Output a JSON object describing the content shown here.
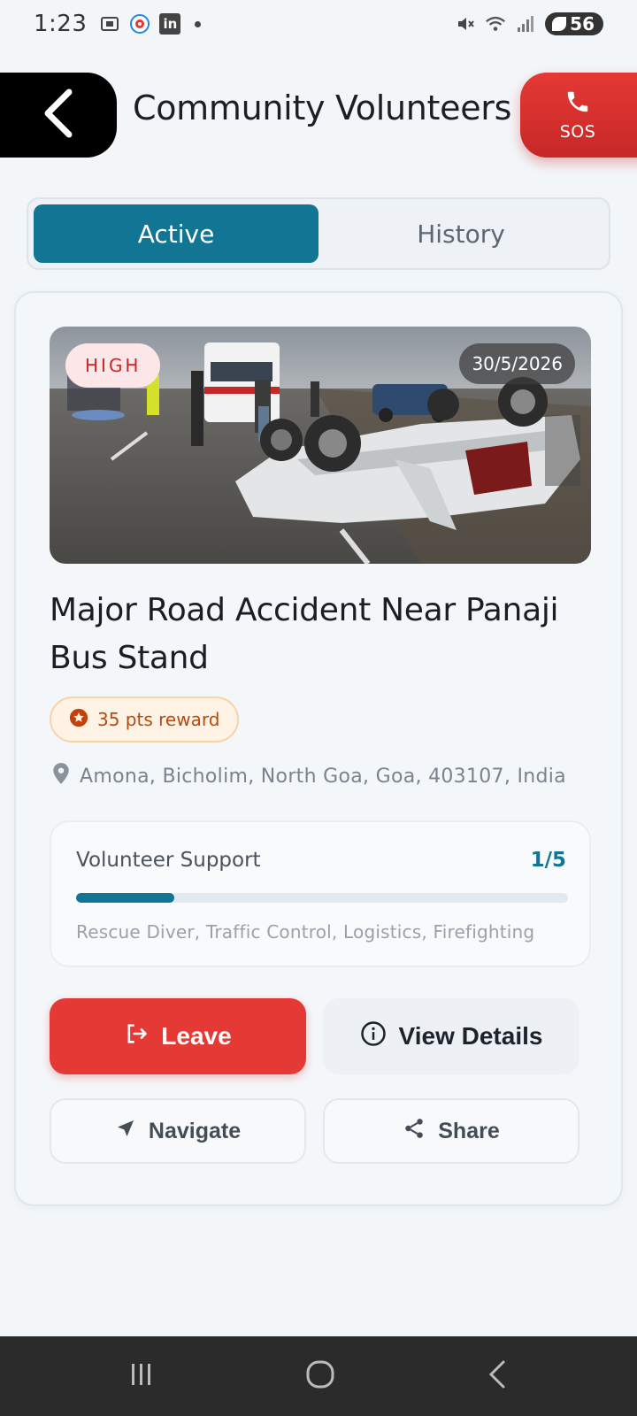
{
  "status_bar": {
    "time": "1:23",
    "battery": "56",
    "icons": [
      "screenshot-icon",
      "app-icon",
      "linkedin-icon",
      "notification-dot",
      "mute-icon",
      "wifi-icon",
      "signal-icon",
      "battery-icon"
    ]
  },
  "header": {
    "title": "Community Volunteers",
    "back_icon": "chevron-left-icon",
    "sos_label": "SOS",
    "sos_icon": "phone-icon"
  },
  "tabs": [
    {
      "label": "Active",
      "active": true
    },
    {
      "label": "History",
      "active": false
    }
  ],
  "incident": {
    "severity": "HIGH",
    "date": "30/5/2026",
    "title": "Major Road Accident Near Panaji Bus Stand",
    "reward": "35 pts reward",
    "location": "Amona, Bicholim, North Goa, Goa, 403107, India",
    "support": {
      "label": "Volunteer Support",
      "count": "1/5",
      "progress_fraction": 0.2,
      "skills": "Rescue Diver, Traffic Control, Logistics, Firefighting"
    }
  },
  "actions": {
    "leave": "Leave",
    "view_details": "View Details",
    "navigate": "Navigate",
    "share": "Share"
  },
  "colors": {
    "primary": "#137594",
    "danger": "#e53935",
    "high_badge_bg": "#fde6e8",
    "reward_text": "#b8480f"
  }
}
